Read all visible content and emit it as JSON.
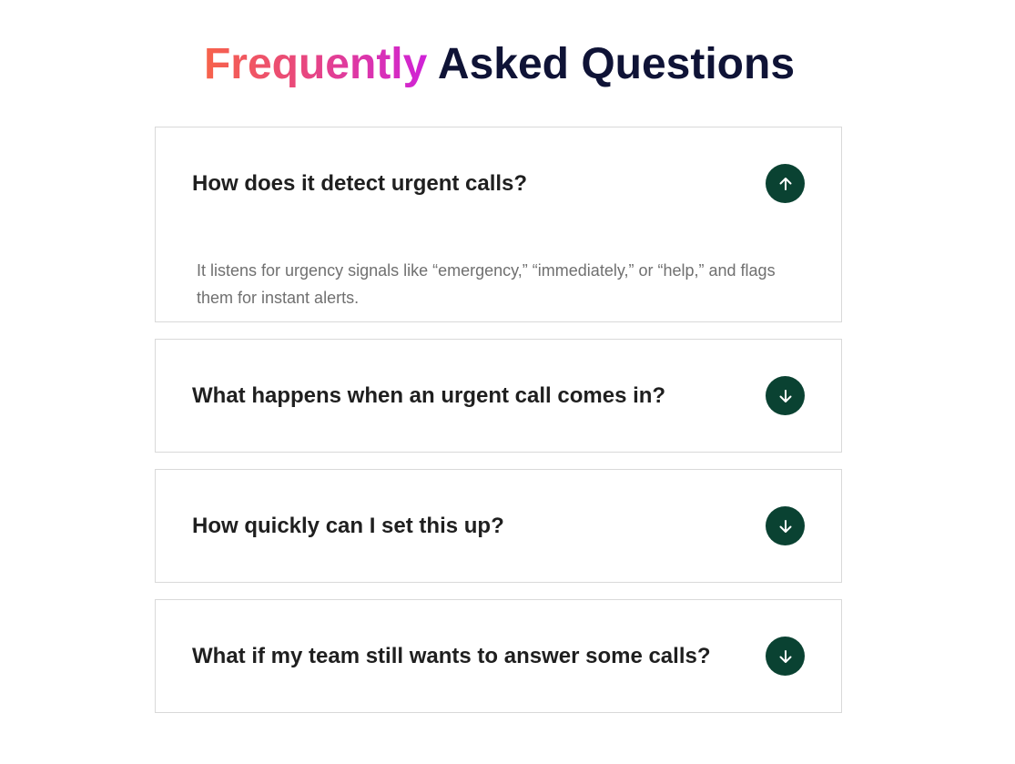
{
  "heading": {
    "highlight": "Frequently",
    "rest": "Asked Questions"
  },
  "faq": {
    "items": [
      {
        "question": "How does it detect urgent calls?",
        "answer": "It listens for urgency signals like “emergency,” “immediately,” or “help,” and flags them for instant alerts.",
        "expanded": true,
        "toggle_icon": "arrow-up-icon"
      },
      {
        "question": "What happens when an urgent call comes in?",
        "expanded": false,
        "toggle_icon": "arrow-down-icon"
      },
      {
        "question": "How quickly can I set this up?",
        "expanded": false,
        "toggle_icon": "arrow-down-icon"
      },
      {
        "question": "What if my team still wants to answer some calls?",
        "expanded": false,
        "toggle_icon": "arrow-down-icon"
      }
    ]
  },
  "colors": {
    "accent_button": "#0a4232",
    "heading_dark": "#0f1336",
    "gradient_start": "#f7634a",
    "gradient_end": "#cf22d8"
  }
}
